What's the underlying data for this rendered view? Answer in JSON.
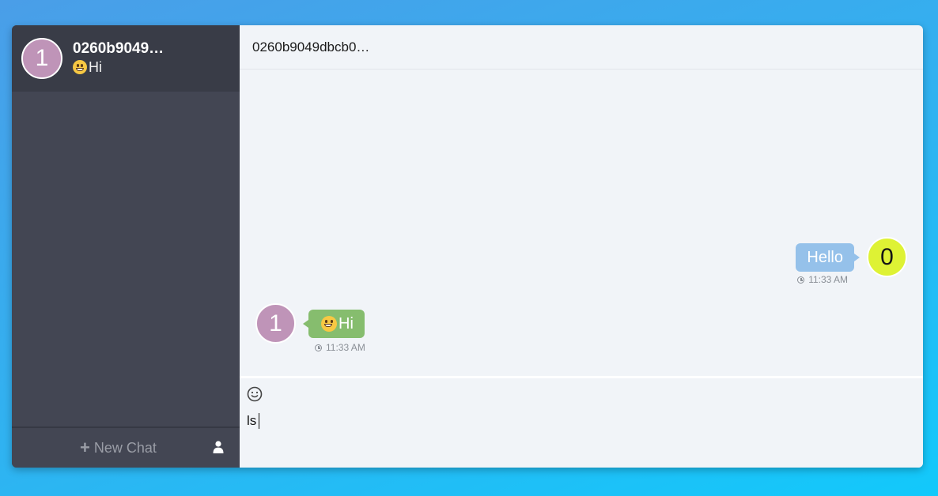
{
  "sidebar": {
    "chats": [
      {
        "avatar_label": "1",
        "name": "0260b9049…",
        "preview": "Hi",
        "avatar_color": "#bf94b8"
      }
    ],
    "new_chat_label": "New Chat",
    "user_icon": "user-icon"
  },
  "main": {
    "header_title": "0260b9049dbcb0…",
    "messages": [
      {
        "direction": "out",
        "text": "Hello",
        "avatar_label": "0",
        "time": "11:33 AM",
        "bubble_color": "#95c1ea",
        "avatar_color": "#def234"
      },
      {
        "direction": "in",
        "text": "Hi",
        "avatar_label": "1",
        "time": "11:33 AM",
        "bubble_color": "#86bd6e",
        "avatar_color": "#bf94b8"
      }
    ],
    "composer": {
      "emoji_icon": "smile-icon",
      "value": "ls"
    }
  }
}
